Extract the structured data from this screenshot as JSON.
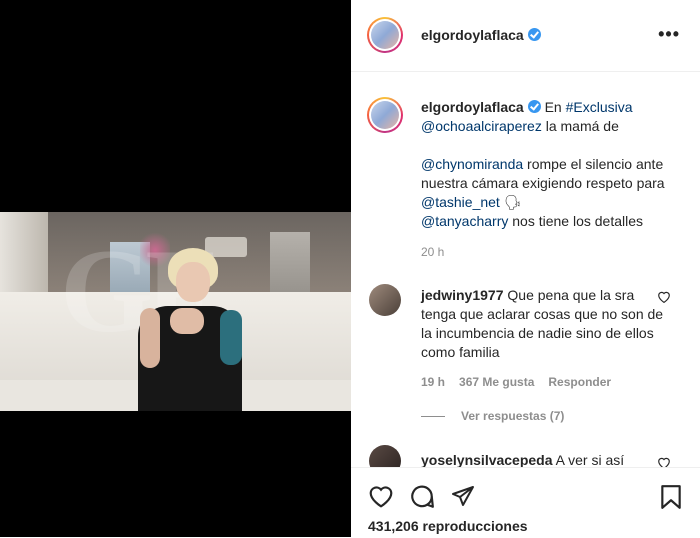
{
  "post": {
    "username": "elgordoylaflaca",
    "caption": {
      "part1": "En ",
      "tag1": "#Exclusiva",
      "mention1": "@ochoaalciraperez",
      "part2": " la mamá de",
      "mention2": "@chynomiranda",
      "part3": " rompe el silencio ante nuestra cámara exigiendo respeto para ",
      "mention3": "@tashie_net",
      "emoji": "🗣",
      "mention4": "@tanyacharry",
      "part4": " nos tiene los detalles"
    },
    "time": "20 h"
  },
  "comments": [
    {
      "username": "jedwiny1977",
      "text": " Que pena que la sra tenga que aclarar cosas que no son de la incumbencia de nadie sino de ellos como familia",
      "time": "19 h",
      "likes": "367 Me gusta",
      "reply": "Responder",
      "view_replies": "Ver respuestas (7)"
    },
    {
      "username": "yoselynsilvacepeda",
      "text": " A ver si así"
    }
  ],
  "footer": {
    "views": "431,206 reproducciones"
  },
  "icons": {
    "more": "more-options-icon",
    "like": "heart-icon",
    "comment": "comment-icon",
    "share": "share-icon",
    "save": "bookmark-icon"
  }
}
